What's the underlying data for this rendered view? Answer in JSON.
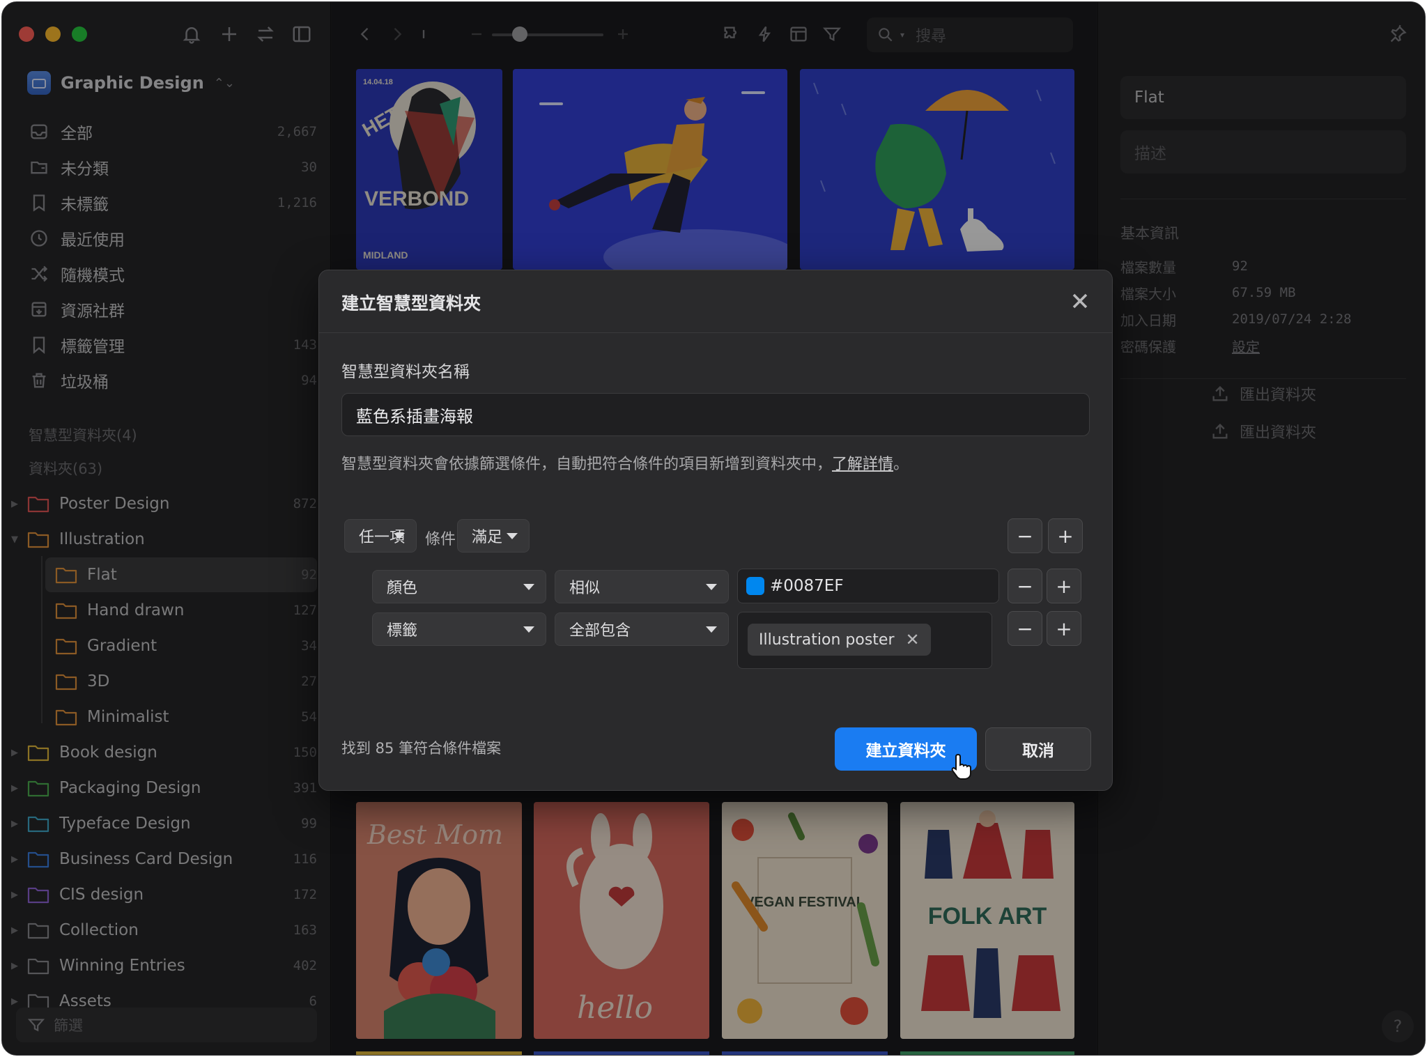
{
  "window": {
    "traffic_colors": [
      "#ff5f57",
      "#febc2e",
      "#28c840"
    ]
  },
  "sidebar": {
    "library_name": "Graphic Design",
    "nav": [
      {
        "label": "全部",
        "count": "2,667",
        "icon": "inbox-icon"
      },
      {
        "label": "未分類",
        "count": "30",
        "icon": "unsorted-icon"
      },
      {
        "label": "未標籤",
        "count": "1,216",
        "icon": "untagged-icon"
      },
      {
        "label": "最近使用",
        "count": "",
        "icon": "clock-icon"
      },
      {
        "label": "隨機模式",
        "count": "",
        "icon": "shuffle-icon"
      },
      {
        "label": "資源社群",
        "count": "",
        "icon": "community-icon"
      },
      {
        "label": "標籤管理",
        "count": "143",
        "icon": "bookmark-icon"
      },
      {
        "label": "垃圾桶",
        "count": "94",
        "icon": "trash-icon"
      }
    ],
    "smart_folders_title": "智慧型資料夾(4)",
    "folders_title": "資料夾(63)",
    "folders": [
      {
        "label": "Poster Design",
        "count": "872",
        "color": "#e05555"
      },
      {
        "label": "Illustration",
        "count": "",
        "color": "#e0913b"
      },
      {
        "label": "Flat",
        "count": "92",
        "color": "#e0913b"
      },
      {
        "label": "Hand drawn",
        "count": "127",
        "color": "#e0913b"
      },
      {
        "label": "Gradient",
        "count": "34",
        "color": "#e0913b"
      },
      {
        "label": "3D",
        "count": "27",
        "color": "#e0913b"
      },
      {
        "label": "Minimalist",
        "count": "54",
        "color": "#e0913b"
      },
      {
        "label": "Book design",
        "count": "150",
        "color": "#e0b93b"
      },
      {
        "label": "Packaging Design",
        "count": "391",
        "color": "#4caf50"
      },
      {
        "label": "Typeface Design",
        "count": "99",
        "color": "#3fa9c9"
      },
      {
        "label": "Business Card Design",
        "count": "116",
        "color": "#3b7fe0"
      },
      {
        "label": "CIS design",
        "count": "172",
        "color": "#8e63d6"
      },
      {
        "label": "Collection",
        "count": "163",
        "color": "#8a8a8e"
      },
      {
        "label": "Winning Entries",
        "count": "402",
        "color": "#8a8a8e"
      },
      {
        "label": "Assets",
        "count": "6",
        "color": "#8a8a8e"
      }
    ],
    "filter_placeholder": "篩選"
  },
  "toolbar": {
    "search_placeholder": "搜尋",
    "zoom_level": 0.25
  },
  "thumbnails": {
    "top": [
      {
        "name": "poster-het-verbond",
        "bg": "#2d39b8",
        "lines": [
          "14.04.18",
          "HET",
          "VERBOND",
          "MIDLAND"
        ]
      },
      {
        "name": "running-man-illustration",
        "bg": "#3340d6"
      },
      {
        "name": "umbrella-goose-illustration",
        "bg": "#3040c8"
      }
    ],
    "bottom": [
      {
        "name": "best-mom-card",
        "bg": "#d8856e",
        "text": "Best Mom"
      },
      {
        "name": "hello-rabbit-card",
        "bg": "#d86a5e",
        "text": "hello"
      },
      {
        "name": "vegan-festival-poster",
        "bg": "#efe2cf",
        "text": "VEGAN FESTIVAL"
      },
      {
        "name": "folk-art-poster",
        "bg": "#efe4d2",
        "text": "FOLK ART"
      }
    ]
  },
  "inspector": {
    "title_value": "Flat",
    "desc_placeholder": "描述",
    "section_title": "基本資訊",
    "info": [
      {
        "k": "檔案數量",
        "v": "92"
      },
      {
        "k": "檔案大小",
        "v": "67.59 MB"
      },
      {
        "k": "加入日期",
        "v": "2019/07/24 2:28"
      },
      {
        "k": "密碼保護",
        "v": "設定"
      }
    ],
    "export_1": "匯出資料夾",
    "export_2": "匯出資料夾",
    "help": "?"
  },
  "dialog": {
    "title": "建立智慧型資料夾",
    "name_label": "智慧型資料夾名稱",
    "name_value": "藍色系插畫海報",
    "desc": "智慧型資料夾會依據篩選條件，自動把符合條件的項目新增到資料夾中，",
    "learn_more": "了解詳情",
    "desc_end": "。",
    "match_mode": "任一項",
    "condition_label": "條件",
    "condition_mode": "滿足",
    "rule1": {
      "field": "顏色",
      "op": "相似",
      "value": "#0087EF",
      "swatch": "#0087EF"
    },
    "rule2": {
      "field": "標籤",
      "op": "全部包含",
      "tag": "Illustration poster"
    },
    "minus": "−",
    "plus": "+",
    "found_text": "找到 85 筆符合條件檔案",
    "create_button": "建立資料夾",
    "cancel_button": "取消",
    "primary_color": "#1a7cf2"
  }
}
